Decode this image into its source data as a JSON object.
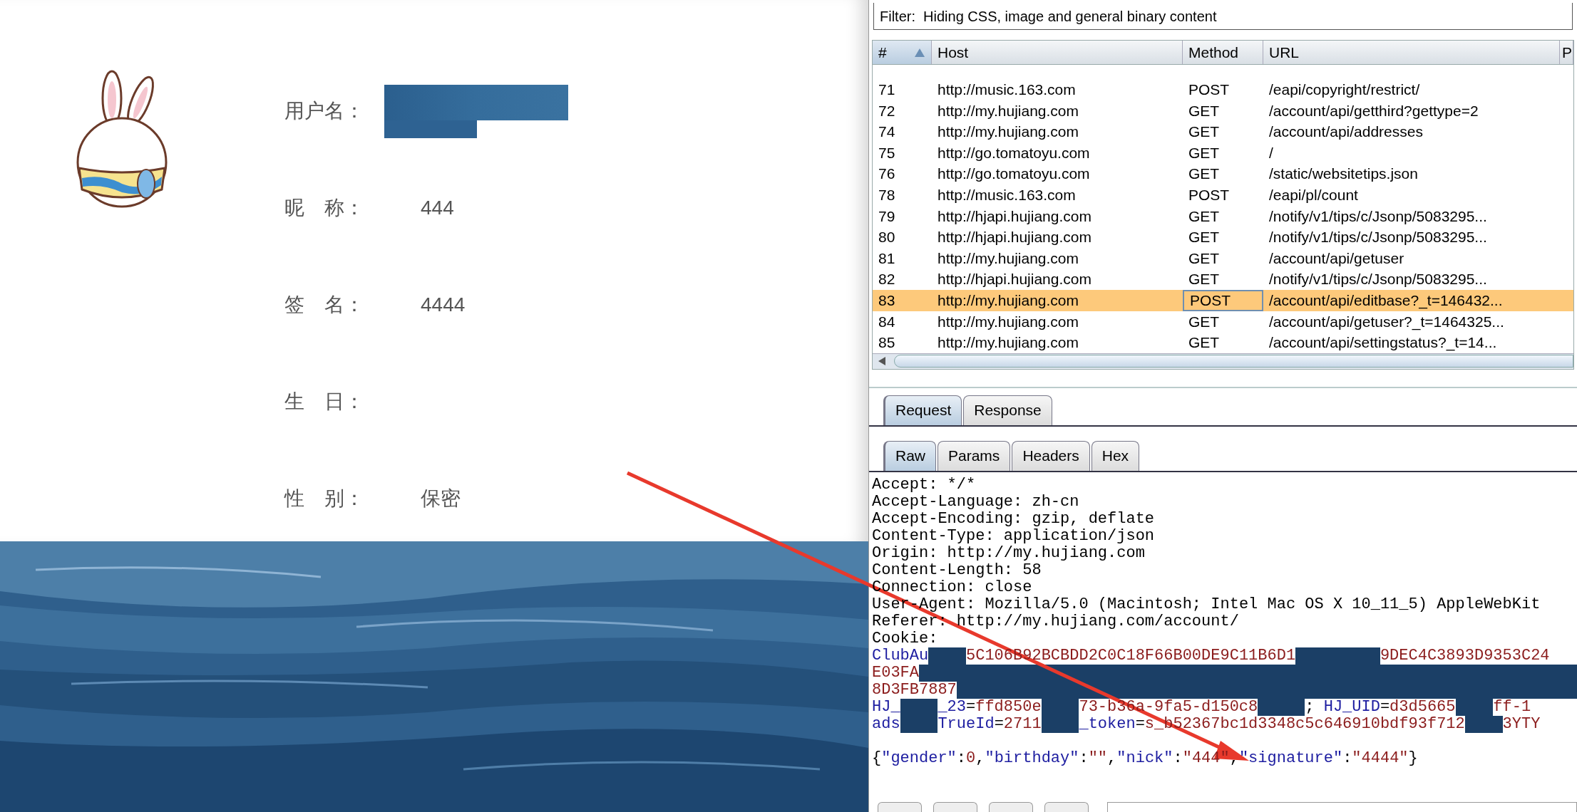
{
  "profile": {
    "fields": [
      {
        "label": "用户名：",
        "kind": "redacted"
      },
      {
        "label": "昵　称：",
        "kind": "text",
        "value": "444"
      },
      {
        "label": "签　名：",
        "kind": "text",
        "value": "4444"
      },
      {
        "label": "生　日：",
        "kind": "text"
      },
      {
        "label": "性　别：",
        "kind": "text",
        "value": "保密"
      }
    ]
  },
  "filter": "Filter:  Hiding CSS, image and general binary content",
  "table": {
    "columns": [
      {
        "label": "#",
        "sorted": true
      },
      {
        "label": "Host",
        "sorted": false
      },
      {
        "label": "Method",
        "sorted": false
      },
      {
        "label": "URL",
        "sorted": false
      },
      {
        "label": "P",
        "sorted": false
      }
    ],
    "rows": [
      {
        "number": "71",
        "host": "http://music.163.com",
        "method": "POST",
        "url": "/eapi/copyright/restrict/",
        "selected": false
      },
      {
        "number": "72",
        "host": "http://my.hujiang.com",
        "method": "GET",
        "url": "/account/api/getthird?gettype=2",
        "selected": false
      },
      {
        "number": "74",
        "host": "http://my.hujiang.com",
        "method": "GET",
        "url": "/account/api/addresses",
        "selected": false
      },
      {
        "number": "75",
        "host": "http://go.tomatoyu.com",
        "method": "GET",
        "url": "/",
        "selected": false
      },
      {
        "number": "76",
        "host": "http://go.tomatoyu.com",
        "method": "GET",
        "url": "/static/websitetips.json",
        "selected": false
      },
      {
        "number": "78",
        "host": "http://music.163.com",
        "method": "POST",
        "url": "/eapi/pl/count",
        "selected": false
      },
      {
        "number": "79",
        "host": "http://hjapi.hujiang.com",
        "method": "GET",
        "url": "/notify/v1/tips/c/Jsonp/5083295...",
        "selected": false
      },
      {
        "number": "80",
        "host": "http://hjapi.hujiang.com",
        "method": "GET",
        "url": "/notify/v1/tips/c/Jsonp/5083295...",
        "selected": false
      },
      {
        "number": "81",
        "host": "http://my.hujiang.com",
        "method": "GET",
        "url": "/account/api/getuser",
        "selected": false
      },
      {
        "number": "82",
        "host": "http://hjapi.hujiang.com",
        "method": "GET",
        "url": "/notify/v1/tips/c/Jsonp/5083295...",
        "selected": false
      },
      {
        "number": "83",
        "host": "http://my.hujiang.com",
        "method": "POST",
        "url": "/account/api/editbase?_t=146432...",
        "selected": true
      },
      {
        "number": "84",
        "host": "http://my.hujiang.com",
        "method": "GET",
        "url": "/account/api/getuser?_t=1464325...",
        "selected": false
      },
      {
        "number": "85",
        "host": "http://my.hujiang.com",
        "method": "GET",
        "url": "/account/api/settingstatus?_t=14...",
        "selected": false
      }
    ]
  },
  "message_tabs": [
    {
      "label": "Request",
      "selected": true
    },
    {
      "label": "Response",
      "selected": false
    }
  ],
  "view_tabs": [
    {
      "label": "Raw",
      "selected": true
    },
    {
      "label": "Params",
      "selected": false
    },
    {
      "label": "Headers",
      "selected": false
    },
    {
      "label": "Hex",
      "selected": false
    }
  ],
  "raw": {
    "header_lines": [
      "Accept: */*",
      "Accept-Language: zh-cn",
      "Accept-Encoding: gzip, deflate",
      "Content-Type: application/json",
      "Origin: http://my.hujiang.com",
      "Content-Length: 58",
      "Connection: close",
      "User-Agent: Mozilla/5.0 (Macintosh; Intel Mac OS X 10_11_5) AppleWebKit",
      "Referer: http://my.hujiang.com/account/",
      "Cookie:"
    ],
    "cookie_lines": [
      {
        "parts": [
          {
            "kind": "key",
            "text": "ClubAu"
          },
          {
            "kind": "redacted"
          },
          {
            "kind": "value",
            "text": "5C106B92BCBDD2C0C18F66B00DE9C11B6D1"
          },
          {
            "kind": "redacted"
          },
          {
            "kind": "value",
            "text": "9DEC4C3893D9353C24"
          }
        ]
      },
      {
        "parts": [
          {
            "kind": "value",
            "text": "E03FA"
          },
          {
            "kind": "redacted"
          }
        ]
      },
      {
        "parts": [
          {
            "kind": "value",
            "text": "8D3FB7887"
          },
          {
            "kind": "redacted"
          }
        ]
      },
      {
        "parts": [
          {
            "kind": "key",
            "text": "HJ_"
          },
          {
            "kind": "redacted"
          },
          {
            "kind": "key",
            "text": "_23"
          },
          {
            "kind": "plain",
            "text": "="
          },
          {
            "kind": "value",
            "text": "ffd850e"
          },
          {
            "kind": "redacted"
          },
          {
            "kind": "value",
            "text": "73-b36a-9fa5-d150c8"
          },
          {
            "kind": "redacted"
          },
          {
            "kind": "plain",
            "text": "; "
          },
          {
            "kind": "key",
            "text": "HJ_UID"
          },
          {
            "kind": "plain",
            "text": "="
          },
          {
            "kind": "value",
            "text": "d3d5665"
          },
          {
            "kind": "redacted"
          },
          {
            "kind": "value",
            "text": "ff-1"
          }
        ]
      },
      {
        "parts": [
          {
            "kind": "key",
            "text": "ads"
          },
          {
            "kind": "redacted"
          },
          {
            "kind": "key",
            "text": "TrueId"
          },
          {
            "kind": "plain",
            "text": "="
          },
          {
            "kind": "value",
            "text": "2711"
          },
          {
            "kind": "redacted"
          },
          {
            "kind": "key",
            "text": "_token"
          },
          {
            "kind": "plain",
            "text": "="
          },
          {
            "kind": "value",
            "text": "s_b52367bc1d3348c5c646910bdf93f712"
          },
          {
            "kind": "redacted"
          },
          {
            "kind": "value",
            "text": "3YTY"
          }
        ]
      }
    ],
    "body": [
      {
        "kind": "plain",
        "text": "{"
      },
      {
        "kind": "key",
        "text": "\"gender\""
      },
      {
        "kind": "plain",
        "text": ":"
      },
      {
        "kind": "value",
        "text": "0"
      },
      {
        "kind": "plain",
        "text": ","
      },
      {
        "kind": "key",
        "text": "\"birthday\""
      },
      {
        "kind": "plain",
        "text": ":"
      },
      {
        "kind": "value",
        "text": "\"\""
      },
      {
        "kind": "plain",
        "text": ","
      },
      {
        "kind": "key",
        "text": "\"nick\""
      },
      {
        "kind": "plain",
        "text": ":"
      },
      {
        "kind": "value",
        "text": "\"444\""
      },
      {
        "kind": "plain",
        "text": ","
      },
      {
        "kind": "key",
        "text": "\"signature\""
      },
      {
        "kind": "plain",
        "text": ":"
      },
      {
        "kind": "value",
        "text": "\"4444\""
      },
      {
        "kind": "plain",
        "text": "}"
      }
    ]
  }
}
